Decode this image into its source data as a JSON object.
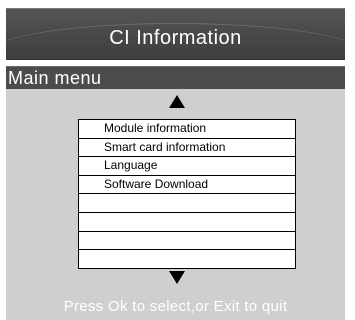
{
  "header": {
    "title": "CI Information"
  },
  "menu": {
    "label": "Main menu"
  },
  "list": {
    "items": [
      "Module information",
      "Smart card information",
      "Language",
      "Software Download",
      "",
      "",
      "",
      ""
    ]
  },
  "footer": {
    "hint": "Press Ok to select,or Exit to quit"
  },
  "colors": {
    "title_bar": "#4a4a4a",
    "menu_bar": "#4c4c4c",
    "panel": "#cfcfcf",
    "list_background": "#ffffff",
    "text_light": "#ffffff",
    "text_dark": "#000000"
  },
  "icons": {
    "scroll_up": "triangle-up",
    "scroll_down": "triangle-down"
  }
}
